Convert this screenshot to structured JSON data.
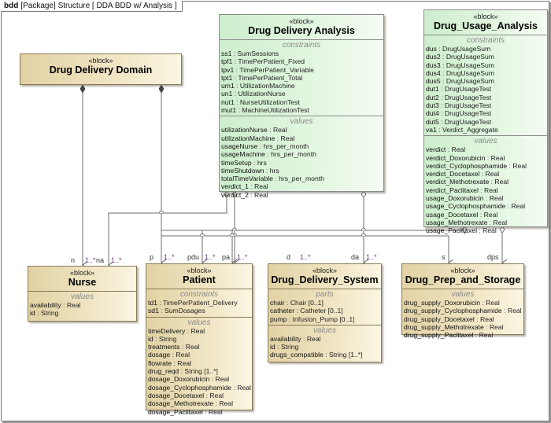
{
  "frame": {
    "kind": "bdd",
    "title": "[Package] Structure [ DDA BDD w/ Analysis ]"
  },
  "blocks": {
    "domain": {
      "stereotype": "«block»",
      "name": "Drug Delivery Domain"
    },
    "analysis": {
      "stereotype": "«block»",
      "name": "Drug Delivery Analysis",
      "constraints_title": "constraints",
      "constraints": [
        {
          "name": "ss1",
          "type": "SumSessions"
        },
        {
          "name": "tpf1",
          "type": "TimePerPatient_Fixed"
        },
        {
          "name": "tpv1",
          "type": "TimePerPatient_Variable"
        },
        {
          "name": "tpt1",
          "type": "TimePerPatient_Total"
        },
        {
          "name": "um1",
          "type": "UtilizationMachine"
        },
        {
          "name": "un1",
          "type": "UtilizationNurse"
        },
        {
          "name": "nut1",
          "type": "NurseUtilizationTest"
        },
        {
          "name": "mut1",
          "type": "MachineUtilizationTest"
        }
      ],
      "values_title": "values",
      "values": [
        {
          "name": "utilizationNurse",
          "type": "Real"
        },
        {
          "name": "utilizationMachine",
          "type": "Real"
        },
        {
          "name": "usageNurse",
          "type": "hrs_per_month"
        },
        {
          "name": "usageMachine",
          "type": "hrs_per_month"
        },
        {
          "name": "timeSetup",
          "type": "hrs"
        },
        {
          "name": "timeShutdown",
          "type": "hrs"
        },
        {
          "name": "totalTimeVariable",
          "type": "hrs_per_month"
        },
        {
          "name": "verdict_1",
          "type": "Real"
        },
        {
          "name": "verdict_2",
          "type": "Real"
        }
      ]
    },
    "usage": {
      "stereotype": "«block»",
      "name": "Drug_Usage_Analysis",
      "constraints_title": "constraints",
      "constraints": [
        {
          "name": "dus",
          "type": "DrugUsageSum"
        },
        {
          "name": "dus2",
          "type": "DrugUsageSum"
        },
        {
          "name": "dus3",
          "type": "DrugUsageSum"
        },
        {
          "name": "dus4",
          "type": "DrugUsageSum"
        },
        {
          "name": "dus5",
          "type": "DrugUsageSum"
        },
        {
          "name": "dut1",
          "type": "DrugUsageTest"
        },
        {
          "name": "dut2",
          "type": "DrugUsageTest"
        },
        {
          "name": "dut3",
          "type": "DrugUsageTest"
        },
        {
          "name": "dut4",
          "type": "DrugUsageTest"
        },
        {
          "name": "dut5",
          "type": "DrugUsageTest"
        },
        {
          "name": "va1",
          "type": "Verdict_Aggregate"
        }
      ],
      "values_title": "values",
      "values": [
        {
          "name": "verdict",
          "type": "Real"
        },
        {
          "name": "verdict_Doxorubicin",
          "type": "Real"
        },
        {
          "name": "verdict_Cyclophosphamide",
          "type": "Real"
        },
        {
          "name": "verdict_Docetaxel",
          "type": "Real"
        },
        {
          "name": "verdict_Methotrexate",
          "type": "Real"
        },
        {
          "name": "verdict_Paclitaxel",
          "type": "Real"
        },
        {
          "name": "usage_Doxorubicin",
          "type": "Real"
        },
        {
          "name": "usage_Cyclophosphamide",
          "type": "Real"
        },
        {
          "name": "usage_Docetaxel",
          "type": "Real"
        },
        {
          "name": "usage_Methotrexate",
          "type": "Real"
        },
        {
          "name": "usage_Paclitaxel",
          "type": "Real"
        }
      ]
    },
    "nurse": {
      "stereotype": "«block»",
      "name": "Nurse",
      "values_title": "values",
      "values": [
        {
          "name": "availability",
          "type": "Real"
        },
        {
          "name": "id",
          "type": "String"
        }
      ]
    },
    "patient": {
      "stereotype": "«block»",
      "name": "Patient",
      "constraints_title": "constraints",
      "constraints": [
        {
          "name": "td1",
          "type": "TimePerPatient_Delivery"
        },
        {
          "name": "sd1",
          "type": "SumDosages"
        }
      ],
      "values_title": "values",
      "values": [
        {
          "name": "timeDelivery",
          "type": "Real"
        },
        {
          "name": "id",
          "type": "String"
        },
        {
          "name": "treatments",
          "type": "Real"
        },
        {
          "name": "dosage",
          "type": "Real"
        },
        {
          "name": "flowrate",
          "type": "Real"
        },
        {
          "name": "drug_reqd",
          "type": "String [1..*]"
        },
        {
          "name": "dosage_Doxorubicin",
          "type": "Real"
        },
        {
          "name": "dosage_Cyclophosphamide",
          "type": "Real"
        },
        {
          "name": "dosage_Docetaxel",
          "type": "Real"
        },
        {
          "name": "dosage_Methotrexate",
          "type": "Real"
        },
        {
          "name": "dosage_Paclitaxel",
          "type": "Real"
        }
      ]
    },
    "dds": {
      "stereotype": "«block»",
      "name": "Drug_Delivery_System",
      "parts_title": "parts",
      "parts": [
        {
          "name": "chair",
          "type": "Chair [0..1]"
        },
        {
          "name": "catheter",
          "type": "Catheter [0..1]"
        },
        {
          "name": "pump",
          "type": "Infusion_Pump [0..1]"
        }
      ],
      "values_title": "values",
      "values": [
        {
          "name": "availability",
          "type": "Real"
        },
        {
          "name": "id",
          "type": "String"
        },
        {
          "name": "drugs_compatible",
          "type": "String [1..*]"
        }
      ]
    },
    "prep": {
      "stereotype": "«block»",
      "name": "Drug_Prep_and_Storage",
      "values_title": "values",
      "values": [
        {
          "name": "drug_supply_Doxorubicin",
          "type": "Real"
        },
        {
          "name": "drug_supply_Cyclophosphamide",
          "type": "Real"
        },
        {
          "name": "drug_supply_Docetaxel",
          "type": "Real"
        },
        {
          "name": "drug_supply_Methotrexate",
          "type": "Real"
        },
        {
          "name": "drug_supply_Paclitaxel",
          "type": "Real"
        }
      ]
    }
  },
  "association_ends": [
    {
      "role": "n",
      "multiplicity": "1..*"
    },
    {
      "role": "na",
      "multiplicity": "1..*"
    },
    {
      "role": "p",
      "multiplicity": "1..*"
    },
    {
      "role": "pdu",
      "multiplicity": "1..*"
    },
    {
      "role": "pa",
      "multiplicity": "1..*"
    },
    {
      "role": "d",
      "multiplicity": "1..*"
    },
    {
      "role": "da",
      "multiplicity": "1..*"
    },
    {
      "role": "s",
      "multiplicity": ""
    },
    {
      "role": "dps",
      "multiplicity": ""
    }
  ]
}
